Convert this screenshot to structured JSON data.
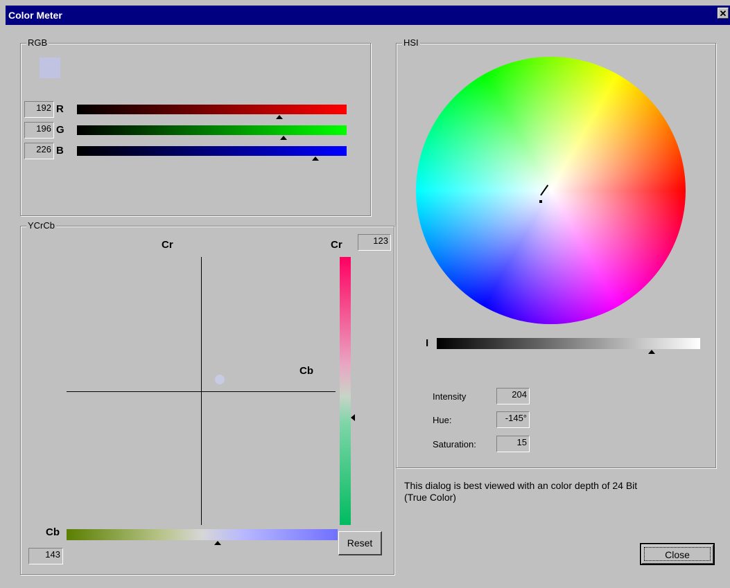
{
  "window": {
    "title": "Color Meter",
    "close_glyph": "✕"
  },
  "rgb": {
    "group_label": "RGB",
    "swatch_color": "#c0c4e2",
    "channels": [
      {
        "label": "R",
        "value": "192",
        "level": 0.753
      },
      {
        "label": "G",
        "value": "196",
        "level": 0.769
      },
      {
        "label": "B",
        "value": "226",
        "level": 0.886
      }
    ]
  },
  "ycrcb": {
    "group_label": "YCrCb",
    "cr_axis_label": "Cr",
    "cb_axis_label": "Cb",
    "cr_bar_label": "Cr",
    "cr_value": "123",
    "cb_bar_label": "Cb",
    "cb_value": "143",
    "reset_label": "Reset"
  },
  "hsi": {
    "group_label": "HSI",
    "i_label": "I",
    "intensity_label": "Intensity",
    "intensity_value": "204",
    "hue_label": "Hue:",
    "hue_value": "-145°",
    "saturation_label": "Saturation:",
    "saturation_value": "15",
    "intensity_level": 0.8
  },
  "note": {
    "line1": "This dialog is best viewed with an color depth of 24 Bit",
    "line2": "(True Color)"
  },
  "footer": {
    "close_label": "Close"
  }
}
